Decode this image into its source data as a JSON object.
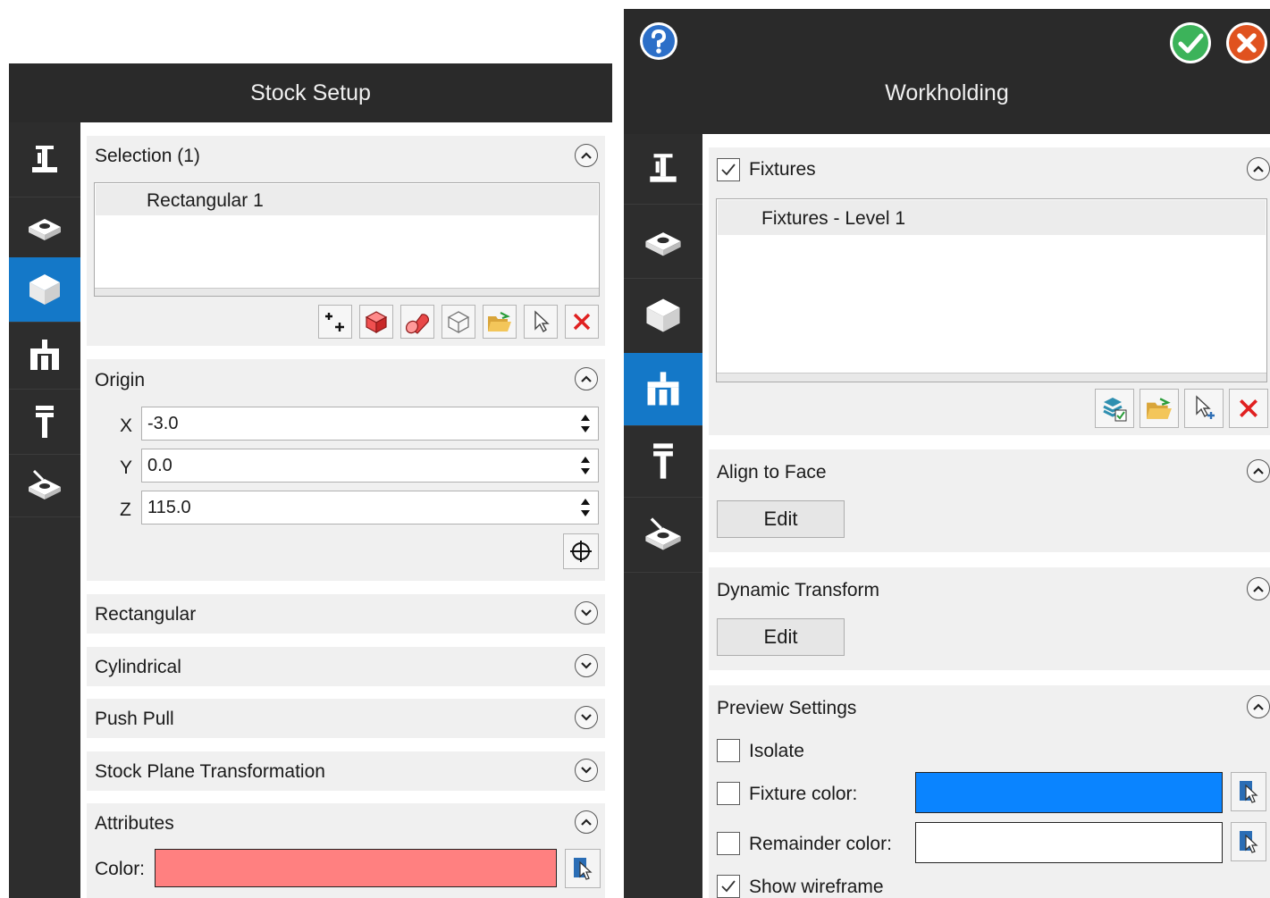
{
  "stock_setup": {
    "title": "Stock Setup",
    "selection": {
      "header": "Selection (1)",
      "items": [
        "Rectangular 1"
      ]
    },
    "origin": {
      "header": "Origin",
      "x_label": "X",
      "x_value": "-3.0",
      "y_label": "Y",
      "y_value": "0.0",
      "z_label": "Z",
      "z_value": "115.0"
    },
    "collapsed_sections": [
      "Rectangular",
      "Cylindrical",
      "Push Pull",
      "Stock Plane Transformation"
    ],
    "attributes": {
      "header": "Attributes",
      "color_label": "Color:",
      "color": "#ff8080"
    },
    "rail_active_index": 2
  },
  "workholding": {
    "title": "Workholding",
    "fixtures": {
      "header": "Fixtures",
      "checked": true,
      "items": [
        "Fixtures - Level 1"
      ]
    },
    "align_to_face": {
      "header": "Align to Face",
      "button": "Edit"
    },
    "dynamic_transform": {
      "header": "Dynamic Transform",
      "button": "Edit"
    },
    "preview_settings": {
      "header": "Preview Settings",
      "isolate_label": "Isolate",
      "isolate_checked": false,
      "fixture_color_label": "Fixture color:",
      "fixture_color_checked": false,
      "fixture_color": "#0a84ff",
      "remainder_color_label": "Remainder color:",
      "remainder_color_checked": false,
      "remainder_color": "#ffffff",
      "show_wireframe_label": "Show wireframe",
      "show_wireframe_checked": true
    },
    "rail_active_index": 3
  },
  "icons": {
    "help": "help-icon",
    "ok": "checkmark-icon",
    "cancel": "close-icon"
  },
  "colors": {
    "accent": "#1478c8",
    "titlebar": "#2a2a2a",
    "ok_green": "#3cb35a",
    "cancel_red": "#e0521f",
    "delete_red": "#e02020"
  }
}
